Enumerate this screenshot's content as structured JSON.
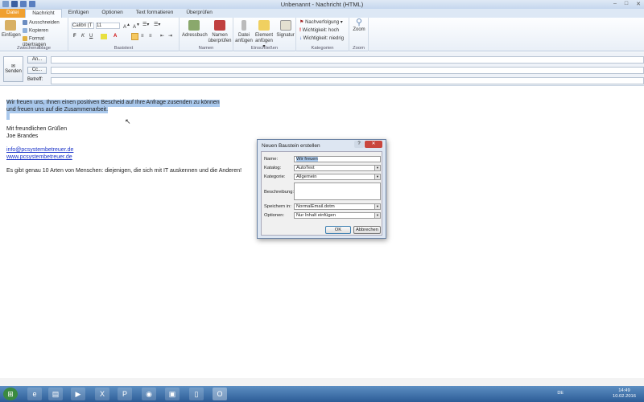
{
  "window": {
    "title": "Unbenannt - Nachricht (HTML)",
    "controls": [
      "–",
      "□",
      "✕"
    ]
  },
  "tabs": [
    "Datei",
    "Nachricht",
    "Einfügen",
    "Optionen",
    "Text formatieren",
    "Überprüfen"
  ],
  "ribbon": {
    "clipboard": {
      "paste": "Einfügen",
      "cut": "Ausschneiden",
      "copy": "Kopieren",
      "format": "Format übertragen",
      "label": "Zwischenablage"
    },
    "basictext": {
      "font": "Calibri (T",
      "size": "11",
      "bold": "F",
      "italic": "K",
      "underline": "U",
      "label": "Basistext"
    },
    "names": {
      "addressbook": "Adressbuch",
      "check1": "Namen",
      "check2": "überprüfen",
      "label": "Namen"
    },
    "include": {
      "file1": "Datei",
      "file2": "anfügen",
      "item1": "Element",
      "item2": "anfügen ▾",
      "signature": "Signatur",
      "label": "Einschließen"
    },
    "tags": {
      "followup": "Nachverfolgung ▾",
      "high": "Wichtigkeit: hoch",
      "low": "Wichtigkeit: niedrig",
      "label": "Kategorien"
    },
    "zoom": {
      "button": "Zoom",
      "label": "Zoom"
    }
  },
  "header": {
    "send": "Senden",
    "to": "An...",
    "cc": "Cc...",
    "subject_label": "Betreff:",
    "to_value": "",
    "cc_value": "",
    "subject_value": ""
  },
  "body": {
    "line1": "Wir freuen uns, Ihnen einen positiven Bescheid auf Ihre Anfrage zusenden zu können",
    "line2": "und freuen uns auf die Zusammenarbeit.",
    "greeting": "Mit freundlichen Grüßen",
    "name": "Joe Brandes",
    "email": "info@pcsystembetreuer.de",
    "web": "www.pcsystembetreuer.de",
    "quote": "Es gibt genau 10 Arten von Menschen: diejenigen, die sich mit IT auskennen und die Anderen!"
  },
  "dialog": {
    "title": "Neuen Baustein erstellen",
    "name_label": "Name:",
    "name_value": "Wir freuen",
    "catalog_label": "Katalog:",
    "catalog_value": "AutoText",
    "category_label": "Kategorie:",
    "category_value": "Allgemein",
    "description_label": "Beschreibung:",
    "description_value": "",
    "save_label": "Speichern in:",
    "save_value": "NormalEmail.dotm",
    "options_label": "Optionen:",
    "options_value": "Nur Inhalt einfügen",
    "ok": "OK",
    "cancel": "Abbrechen",
    "help": "?",
    "close": "✕"
  },
  "taskbar": {
    "lang": "DE",
    "time": "14:49",
    "date": "10.02.2016"
  }
}
